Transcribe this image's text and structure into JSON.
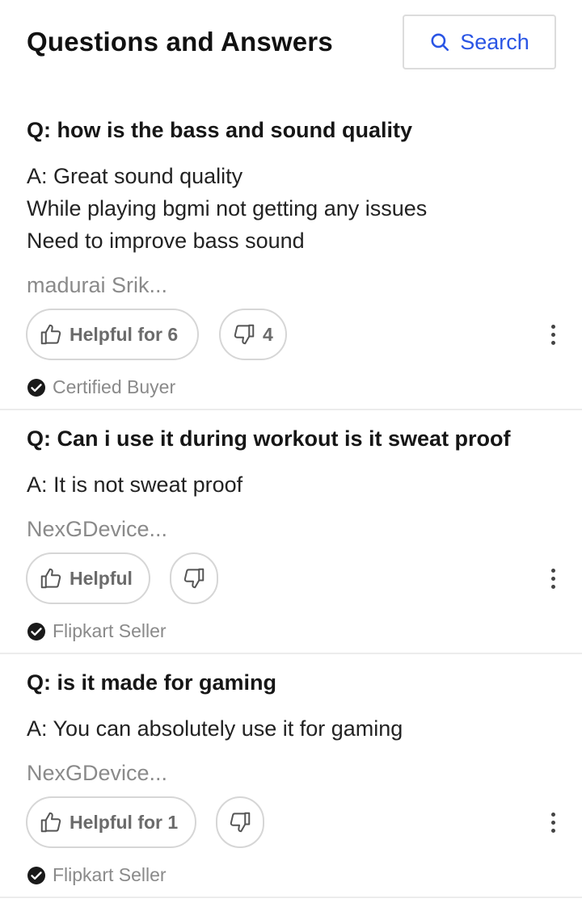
{
  "header": {
    "title": "Questions and Answers",
    "search_label": "Search",
    "accent": "#2a55e5"
  },
  "qa": [
    {
      "question": "Q: how is the bass and sound quality",
      "answer_lines": [
        "A: Great sound quality",
        "While playing bgmi not getting any issues",
        "Need to improve bass sound"
      ],
      "author": "madurai Srik...",
      "helpful_label": "Helpful for 6",
      "dislike_count": "4",
      "badge": "Certified Buyer"
    },
    {
      "question": "Q: Can i use it during workout is it sweat proof",
      "answer_lines": [
        "A: It is not sweat proof"
      ],
      "author": "NexGDevice...",
      "helpful_label": "Helpful",
      "dislike_count": "",
      "badge": "Flipkart Seller"
    },
    {
      "question": "Q: is it made for gaming",
      "answer_lines": [
        "A: You can absolutely use it for gaming"
      ],
      "author": "NexGDevice...",
      "helpful_label": "Helpful for 1",
      "dislike_count": "",
      "badge": "Flipkart Seller"
    }
  ],
  "icons": {
    "search": "search-icon",
    "like": "thumbs-up-icon",
    "dislike": "thumbs-down-icon",
    "more": "more-vertical-icon",
    "check": "check-circle-icon"
  }
}
